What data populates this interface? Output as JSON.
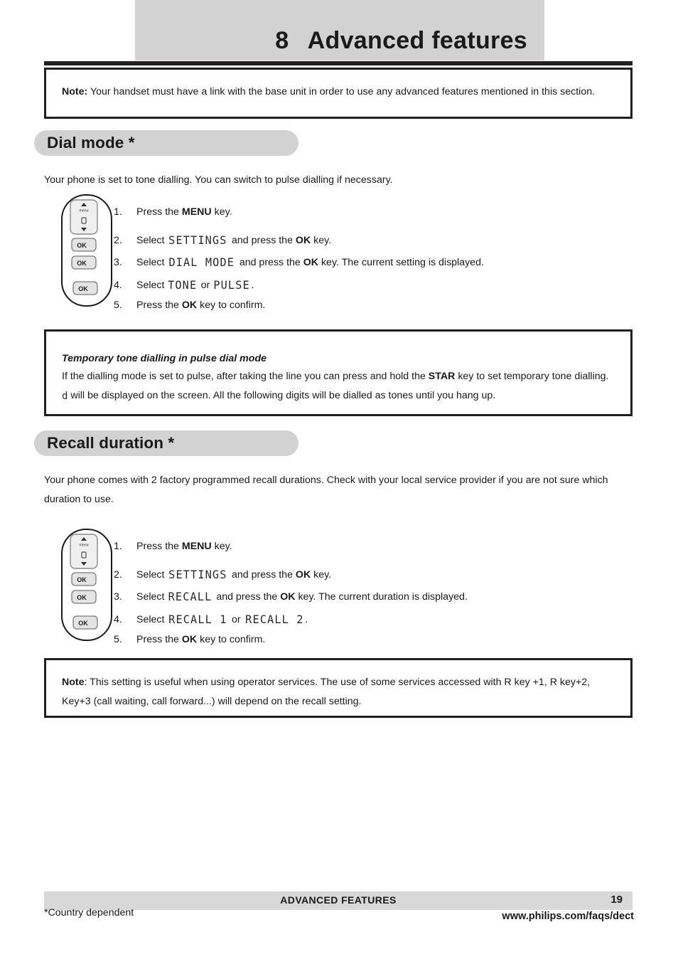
{
  "chapter": {
    "number": "8",
    "title": "Advanced features"
  },
  "note_top": {
    "label": "Note:",
    "text": "Your handset must have a link with the base unit in order to use any advanced features mentioned in this section."
  },
  "dial_mode": {
    "heading": "Dial mode *",
    "intro": "Your phone is set to tone dialling. You can switch to pulse dialling if necessary.",
    "steps": [
      {
        "num": "1.",
        "pre": "Press the ",
        "bold": "MENU",
        "post": " key."
      },
      {
        "num": "2.",
        "pre": "Select ",
        "lcd": "SETTINGS",
        "mid": " and press the ",
        "bold": "OK",
        "post": " key."
      },
      {
        "num": "3.",
        "pre": "Select ",
        "lcd": "DIAL MODE",
        "mid": " and press the ",
        "bold": "OK",
        "post": " key.  The current setting is displayed."
      },
      {
        "num": "4.",
        "pre": "Select ",
        "lcd": "TONE",
        "mid": " or ",
        "lcd2": "PULSE",
        "post": "."
      },
      {
        "num": "5.",
        "pre": "Press the ",
        "bold": "OK",
        "post": " key to confirm."
      }
    ]
  },
  "note_temporary": {
    "subtitle": "Temporary tone dialling in pulse dial mode",
    "part1": "If the dialling mode is set to pulse, after taking the line you can press and hold the ",
    "bold": "STAR",
    "part2": " key to set temporary tone dialling. ",
    "lcd_glyph": "d",
    "part3": " will be displayed on the screen.  All the following digits will be dialled as tones until you hang up."
  },
  "recall_duration": {
    "heading": "Recall duration *",
    "intro": "Your phone comes with 2 factory programmed recall durations.  Check with your local service provider if you are not sure which duration to use.",
    "steps": [
      {
        "num": "1.",
        "pre": "Press the ",
        "bold": "MENU",
        "post": " key."
      },
      {
        "num": "2.",
        "pre": "Select ",
        "lcd": "SETTINGS",
        "mid": " and press the ",
        "bold": "OK",
        "post": " key."
      },
      {
        "num": "3.",
        "pre": "Select ",
        "lcd": "RECALL",
        "mid": " and press the ",
        "bold": "OK",
        "post": " key.  The current duration is displayed."
      },
      {
        "num": "4.",
        "pre": "Select ",
        "lcd": "RECALL 1",
        "mid": " or ",
        "lcd2": "RECALL 2",
        "post": "."
      },
      {
        "num": "5.",
        "pre": "Press the ",
        "bold": "OK",
        "post": " key to confirm."
      }
    ]
  },
  "note_bottom": {
    "label": "Note",
    "text": ": This setting is useful when using operator services. The use of some services accessed with R key +1, R key+2, Key+3 (call waiting, call forward...) will depend on the recall setting."
  },
  "handset": {
    "menu_key_label": "menu",
    "ok_key_label": "OK"
  },
  "footer": {
    "title": "ADVANCED FEATURES",
    "page": "19",
    "country_note": "*Country dependent",
    "url": "www.philips.com/faqs/dect"
  },
  "colors": {
    "banner_gray": "#d2d2d2",
    "rule_black": "#231f20",
    "footer_gray": "#d8d8d8",
    "text": "#1a1a1a"
  }
}
